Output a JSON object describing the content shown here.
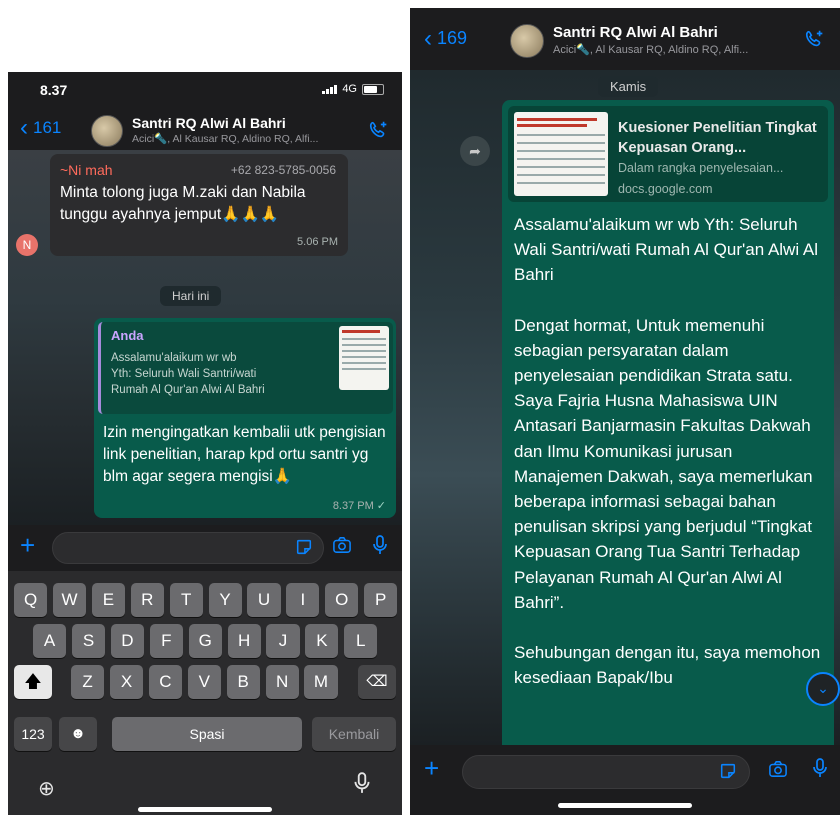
{
  "left": {
    "status": {
      "time": "8.37",
      "network": "4G"
    },
    "header": {
      "back_count": "161",
      "title": "Santri RQ Alwi Al Bahri",
      "subtitle": "Acici🔦, Al Kausar RQ, Aldino RQ, Alfi..."
    },
    "incoming": {
      "sender": "~Ni mah",
      "phone": "+62 823-5785-0056",
      "text": "Minta tolong juga M.zaki dan Nabila tunggu ayahnya jemput🙏🙏🙏",
      "time": "5.06 PM",
      "avatar_letter": "N"
    },
    "date_pill": "Hari ini",
    "outgoing": {
      "reply_name": "Anda",
      "reply_lines": [
        "Assalamu'alaikum wr wb",
        "Yth: Seluruh Wali Santri/wati",
        "Rumah Al Qur'an Alwi Al Bahri"
      ],
      "text": "Izin mengingatkan kembalii utk pengisian link penelitian, harap kpd ortu santri yg blm agar segera mengisi🙏",
      "time": "8.37 PM",
      "check": "✓"
    },
    "keyboard": {
      "row1": [
        "Q",
        "W",
        "E",
        "R",
        "T",
        "Y",
        "U",
        "I",
        "O",
        "P"
      ],
      "row2": [
        "A",
        "S",
        "D",
        "F",
        "G",
        "H",
        "J",
        "K",
        "L"
      ],
      "row3": [
        "Z",
        "X",
        "C",
        "V",
        "B",
        "N",
        "M"
      ],
      "numbers_key": "123",
      "space_key": "Spasi",
      "return_key": "Kembali"
    }
  },
  "right": {
    "header": {
      "back_count": "169",
      "title": "Santri RQ Alwi Al Bahri",
      "subtitle": "Acici🔦, Al Kausar RQ, Aldino RQ, Alfi..."
    },
    "date_pill": "Kamis",
    "link_preview": {
      "title": "Kuesioner Penelitian Tingkat Kepuasan Orang...",
      "description": "Dalam rangka penyelesaian...",
      "domain": "docs.google.com"
    },
    "message_paragraphs": [
      "Assalamu'alaikum wr wb Yth: Seluruh Wali Santri/wati Rumah Al Qur'an Alwi Al Bahri",
      "Dengat hormat, Untuk memenuhi sebagian persyaratan dalam penyelesaian pendidikan Strata satu. Saya Fajria Husna Mahasiswa UIN Antasari Banjarmasin Fakultas Dakwah dan Ilmu Komunikasi jurusan Manajemen Dakwah, saya memerlukan beberapa informasi sebagai bahan penulisan skripsi yang berjudul “Tingkat Kepuasan Orang Tua Santri Terhadap Pelayanan Rumah Al Qur'an Alwi Al Bahri”.",
      "Sehubungan dengan itu, saya memohon kesediaan Bapak/Ibu"
    ]
  },
  "colors": {
    "accent": "#0a84ff",
    "outgoing_bubble": "#085b4b",
    "incoming_bubble": "#2c2c2e",
    "sender_name": "#ff6b5c",
    "reply_name": "#c9a5ff"
  },
  "icons": [
    "back-chevron-icon",
    "add-call-icon",
    "plus-icon",
    "sticker-icon",
    "camera-icon",
    "microphone-icon",
    "globe-icon",
    "shift-icon",
    "backspace-icon",
    "emoji-icon",
    "forward-icon",
    "scroll-down-icon"
  ]
}
